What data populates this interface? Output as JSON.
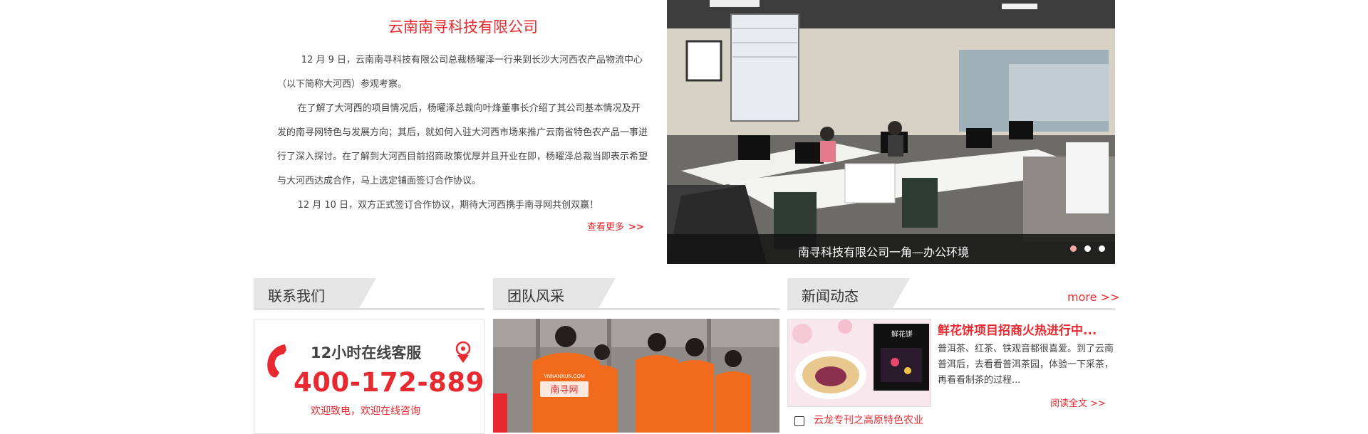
{
  "intro": {
    "title": "云南南寻科技有限公司",
    "paragraphs": [
      "12 月 9 日，云南南寻科技有限公司总裁杨曜泽一行来到长沙大河西农产品物流中心（以下简称大河西）参观考察。",
      "在了解了大河西的项目情况后，杨曜泽总裁向叶烽董事长介绍了其公司基本情况及开发的南寻网特色与发展方向；其后，就如何入驻大河西市场来推广云南省特色农产品一事进行了深入探讨。在了解到大河西目前招商政策优厚并且开业在即，杨曜泽总裁当即表示希望与大河西达成合作，马上选定铺面签订合作协议。",
      "12 月 10 日，双方正式签订合作协议，期待大河西携手南寻网共创双赢！"
    ],
    "read_more": "查看更多",
    "read_more_arrow": ">>"
  },
  "office": {
    "caption": "南寻科技有限公司一角—办公环境",
    "slides": 3,
    "active_slide": 0
  },
  "sections": {
    "contact": "联系我们",
    "team": "团队风采",
    "news": "新闻动态"
  },
  "contact": {
    "title": "12小时在线客服",
    "phone": "400-172-889",
    "subtitle": "欢迎致电，欢迎在线咨询"
  },
  "team": {
    "vest_text": "南寻网",
    "vest_url": "YNNANXUN.COM"
  },
  "news": {
    "more": "more >>",
    "thumb_title": "鲜花饼",
    "title": "鲜花饼项目招商火热进行中...",
    "excerpt": "普洱茶、红茶、铁观音都很喜爱。到了云南普洱后，去看看普洱茶园，体验一下采茶，再看看制茶的过程...",
    "read_full": "阅读全文 >>",
    "item2": "云龙专刊之高原特色农业"
  },
  "colors": {
    "accent": "#e8292f",
    "header_tab": "#e5e5e5",
    "divider": "#e0e0e0"
  }
}
